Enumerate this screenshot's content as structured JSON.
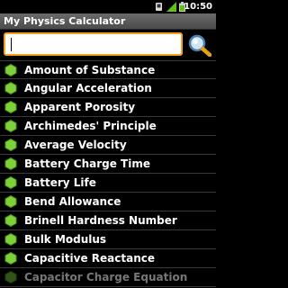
{
  "status_bar": {
    "time": "10:50",
    "icons": [
      "usb-debug-icon",
      "signal-icon",
      "battery-icon"
    ]
  },
  "app": {
    "title": "My Physics Calculator"
  },
  "search": {
    "value": "",
    "placeholder": "",
    "button_icon": "magnifier-icon"
  },
  "accent_color": "#f4a21a",
  "bullet_color": "#7fd13a",
  "list": {
    "items": [
      {
        "label": "Amount of Substance"
      },
      {
        "label": "Angular Acceleration"
      },
      {
        "label": "Apparent Porosity"
      },
      {
        "label": "Archimedes' Principle"
      },
      {
        "label": "Average Velocity"
      },
      {
        "label": "Battery Charge Time"
      },
      {
        "label": "Battery Life"
      },
      {
        "label": "Bend Allowance"
      },
      {
        "label": "Brinell Hardness Number"
      },
      {
        "label": "Bulk Modulus"
      },
      {
        "label": "Capacitive Reactance"
      },
      {
        "label": "Capacitor Charge Equation"
      }
    ]
  }
}
